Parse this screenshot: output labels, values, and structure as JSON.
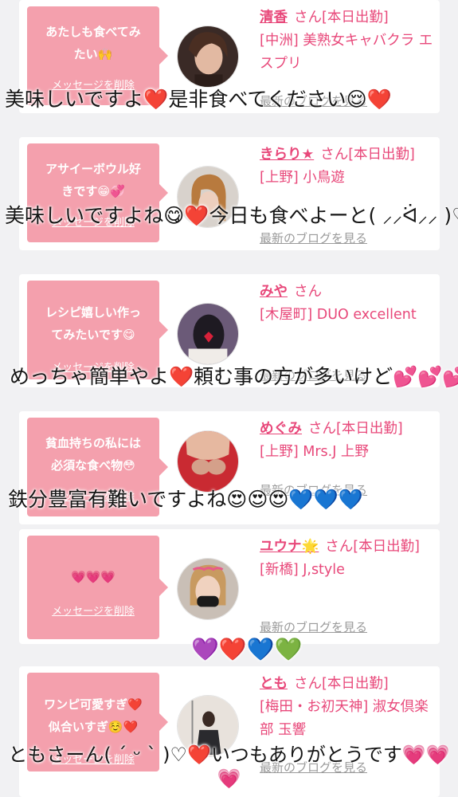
{
  "messages": [
    {
      "bubble": "あたしも食べてみ\nたい🙌",
      "delete_label": "メッセージを削除",
      "name": "清香",
      "honorific": "さん[本日出勤]",
      "shop": "[中洲] 美熟女キャバクラ エスプリ",
      "blog_label": "最新のブログを見る",
      "caption": "美味しいですよ❤️是非食べてください😌❤️"
    },
    {
      "bubble": "アサイーボウル好\nきです😁💞",
      "delete_label": "メッセージを削除",
      "name": "きらり★",
      "honorific": "さん[本日出勤]",
      "shop": "[上野] 小鳥遊",
      "blog_label": "最新のブログを見る",
      "caption": "美味しいですよね😋❤️今日も食べよーと( ⸝⸝ᐛ⸝⸝ )♡"
    },
    {
      "bubble": "レシピ嬉しい作っ\nてみたいです😋",
      "delete_label": "メッセージを削除",
      "name": "みや",
      "honorific": "さん",
      "shop": "[木屋町] DUO excellent",
      "blog_label": "最新のブログを見る",
      "caption": "めっちゃ簡単やよ❤️頼む事の方が多いけど💕💕💕"
    },
    {
      "bubble": "貧血持ちの私には\n必須な食べ物😳",
      "delete_label": "メッセージを削除",
      "name": "めぐみ",
      "honorific": "さん[本日出勤]",
      "shop": "[上野] Mrs.J 上野",
      "blog_label": "最新のブログを見る",
      "caption": "鉄分豊富有難いですよね😍😍😍💙💙💙"
    },
    {
      "bubble": "💗💗💗",
      "delete_label": "メッセージを削除",
      "name": "ユウナ🌟",
      "honorific": "さん[本日出勤]",
      "shop": "[新橋] J,style",
      "blog_label": "最新のブログを見る",
      "caption": "💜❤️💙💚"
    },
    {
      "bubble": "ワンピ可愛すぎ❤️\n似合いすぎ☺️❤️",
      "delete_label": "メッセージを削除",
      "name": "とも",
      "honorific": "さん[本日出勤]",
      "shop": "[梅田・お初天神] 淑女倶楽部 玉響",
      "blog_label": "最新のブログを見る",
      "caption": "ともさーん( ´ ᵕ ` )♡❤️いつもありがとうです💗💗💗"
    }
  ],
  "colors": {
    "accent": "#e8487a",
    "bubble": "#f4a0ad",
    "background": "#f1f1f3",
    "blog_link": "#9a9a9a"
  }
}
